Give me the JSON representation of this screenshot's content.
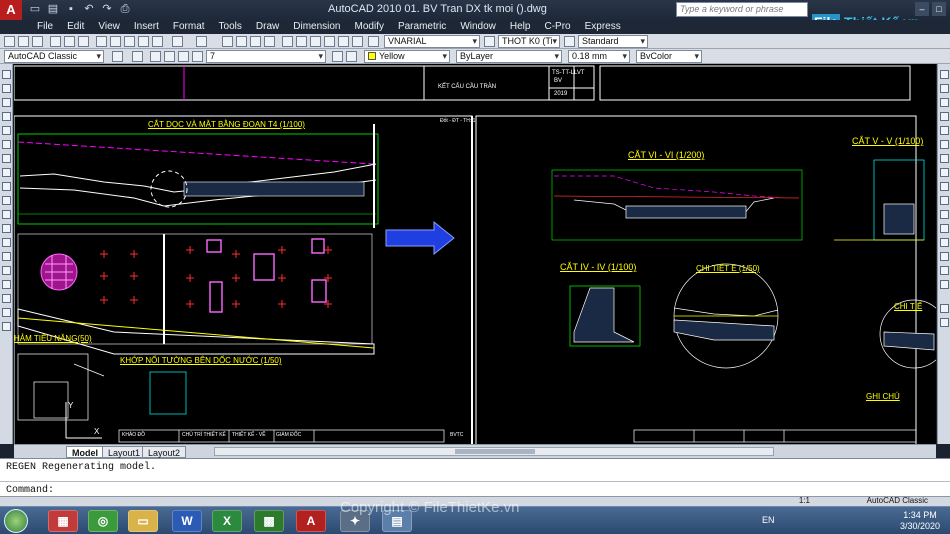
{
  "titlebar": {
    "title": "AutoCAD 2010    01. BV Tran DX tk moi ().dwg",
    "search_placeholder": "Type a keyword or phrase",
    "logo_text": "File",
    "logo_text2": "Thiết Kế.vn"
  },
  "menu": [
    "File",
    "Edit",
    "View",
    "Insert",
    "Format",
    "Tools",
    "Draw",
    "Dimension",
    "Modify",
    "Parametric",
    "Window",
    "Help",
    "C-Pro",
    "Express"
  ],
  "toolbar": {
    "text_style": "VNARIAL",
    "dim_style": "THOT K0 (Ti",
    "table_style": "Standard",
    "workspace": "AutoCAD Classic",
    "layer": "7",
    "color": "Yellow",
    "linetype": "ByLayer",
    "lineweight": "0.18 mm",
    "plotstyle": "BvColor"
  },
  "drawing": {
    "colors": {
      "frame": "#ffffff",
      "section": "#ffff00",
      "dim": "#00ff00",
      "accent": "#ff00ff",
      "red": "#ff2d2d",
      "cyan": "#00ffff",
      "blue_arrow": "#1f3fe0"
    },
    "headers": {
      "title_block_center": "KẾT CẤU CẦU TRÀN",
      "title_block_code": "TS-TT-LLVT",
      "title_block_code2": "BV",
      "title_block_year": "2019",
      "sheet_code": "Đốt - ĐT - TH: 1"
    },
    "labels": {
      "cat_doc": "CẮT DỌC VÀ MẶT BẰNG ĐOẠN T4 (1/100)",
      "cat_vi": "CẮT VI - VI (1/200)",
      "cat_v": "CẮT V - V (1/100)",
      "cat_iv": "CẮT IV - IV (1/100)",
      "chi_tiet_e": "CHI TIẾT E (1/50)",
      "chi_tiet_short": "CHI TIẾ",
      "tham_tieu_nang": "HẢM TIÊU NĂNG(50)",
      "khop_noi": "KHỚP NỐI TƯỜNG BÊN DỐC NƯỚC (1/50)",
      "ghi_chu": "GHI CHÚ"
    },
    "footer_cells": [
      "KHẢO ĐỒ",
      "CHỦ TRÌ THIẾT KẾ",
      "THIẾT KẾ - VẼ",
      "GIÁM ĐỐC",
      "BVTC"
    ]
  },
  "tabs": [
    "Model",
    "Layout1",
    "Layout2"
  ],
  "command": {
    "history": "REGEN Regenerating model.",
    "prompt": "Command:"
  },
  "status": {
    "scale": "1:1",
    "workspace": "AutoCAD Classic"
  },
  "taskbar": {
    "language": "EN",
    "time": "1:34 PM",
    "date": "3/30/2020"
  },
  "watermark": "Copyright © FileThietKe.vn"
}
